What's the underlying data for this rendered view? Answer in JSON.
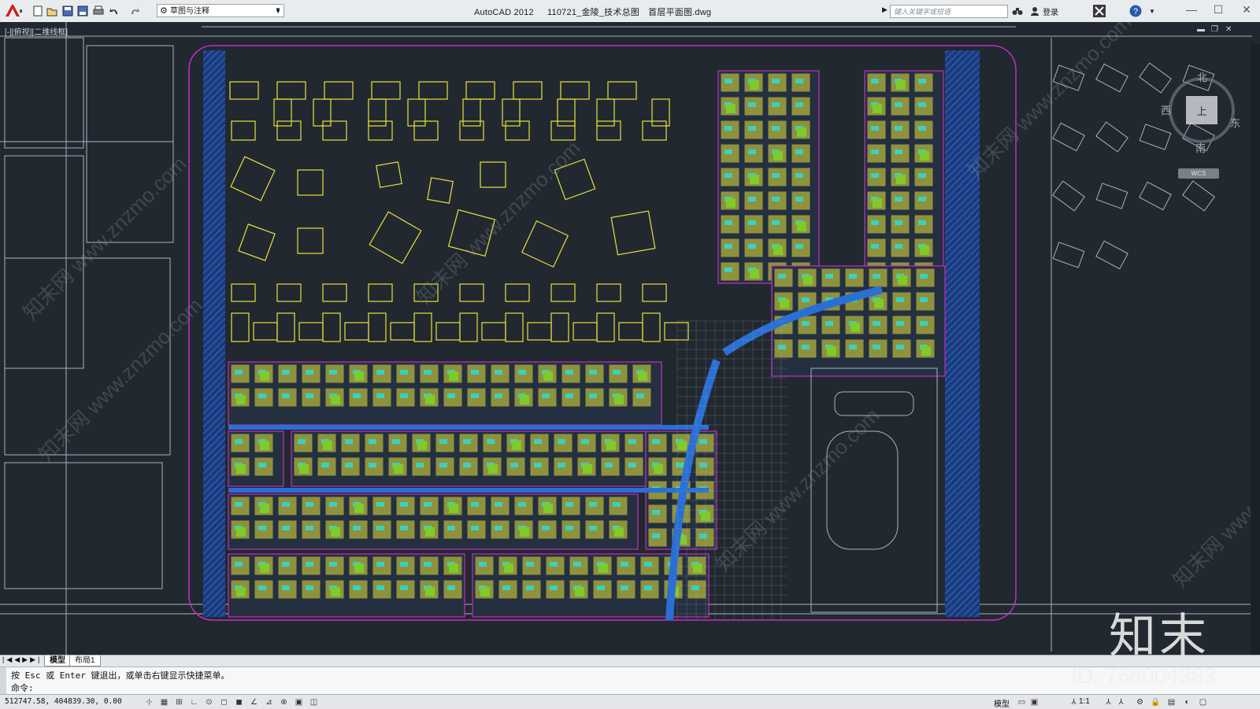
{
  "app": {
    "name": "AutoCAD 2012",
    "file": "110721_金陵_技术总图　首层平面图.dwg",
    "workspace": "草图与注释",
    "search_placeholder": "键入关键字或短语",
    "login_label": "登录"
  },
  "viewport": {
    "label": "[-][俯视][二维线框]",
    "viewcube": {
      "top": "上",
      "north": "北",
      "south": "南",
      "west": "西",
      "east": "东"
    },
    "wcs_label": "WCS"
  },
  "layout_tabs": [
    {
      "label": "模型",
      "active": true
    },
    {
      "label": "布局1",
      "active": false
    }
  ],
  "command": {
    "history": "按 Esc 或 Enter 键退出，或单击右键显示快捷菜单。",
    "prompt": "命令:"
  },
  "status": {
    "coordinates": "512747.58, 404839.30, 0.00",
    "model_label": "模型",
    "scale": "1:1"
  },
  "watermark": {
    "logo": "知末",
    "id": "ID: 768004383",
    "diagonal": "知末网 www.znzmo.com"
  },
  "colors": {
    "canvas_bg": "#212830",
    "yellow": "#e8e23a",
    "magenta": "#c22fc0",
    "blue_hatch": "#2a6fd6",
    "cyan": "#27e0e0",
    "green": "#7ecb2b",
    "grey_line": "#aab2bb"
  },
  "icons": {
    "app_menu": "autocad-logo-icon",
    "quick_access": [
      "new-icon",
      "open-icon",
      "save-icon",
      "saveas-icon",
      "plot-icon",
      "undo-icon",
      "redo-icon"
    ],
    "status_toggles": [
      "snap-icon",
      "grid-icon",
      "ortho-icon",
      "polar-icon",
      "osnap-icon",
      "otrack-icon",
      "ducs-icon",
      "dyn-icon",
      "lwt-icon",
      "tpy-icon",
      "qp-icon",
      "sc-icon"
    ]
  }
}
